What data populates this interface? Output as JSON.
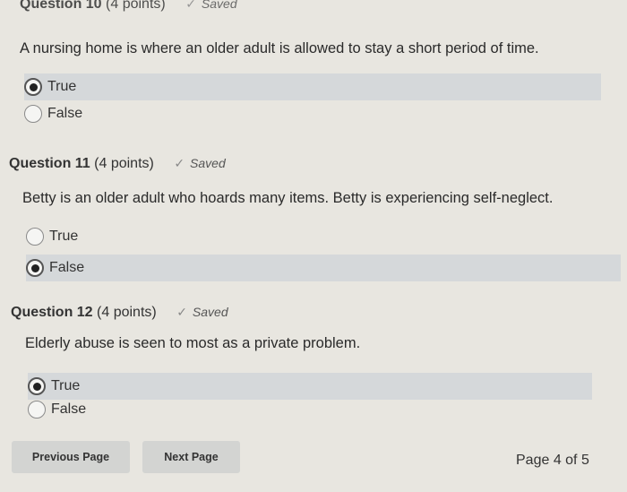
{
  "questions": [
    {
      "title": "Question 10",
      "points": "(4 points)",
      "status": "Saved",
      "text": "A nursing home is where an older adult is allowed to stay a short period of time.",
      "options": [
        {
          "label": "True",
          "selected": true
        },
        {
          "label": "False",
          "selected": false
        }
      ]
    },
    {
      "title": "Question 11",
      "points": "(4 points)",
      "status": "Saved",
      "text": "Betty is an older adult who hoards many items. Betty is experiencing self-neglect.",
      "options": [
        {
          "label": "True",
          "selected": false
        },
        {
          "label": "False",
          "selected": true
        }
      ]
    },
    {
      "title": "Question 12",
      "points": "(4 points)",
      "status": "Saved",
      "text": "Elderly abuse is seen to most as a private problem.",
      "options": [
        {
          "label": "True",
          "selected": true
        },
        {
          "label": "False",
          "selected": false
        }
      ]
    }
  ],
  "icons": {
    "saved": "checkmark-icon"
  },
  "nav": {
    "previous_label": "Previous Page",
    "next_label": "Next Page",
    "page_indicator": "Page 4 of 5"
  }
}
